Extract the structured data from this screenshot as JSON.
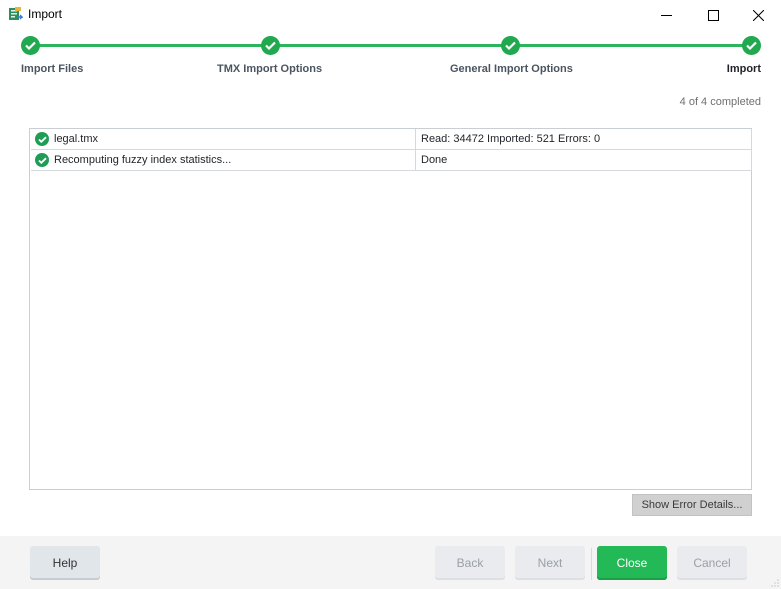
{
  "window": {
    "title": "Import",
    "app_icon": "import-wizard-icon",
    "controls": [
      "minimize",
      "maximize",
      "close"
    ]
  },
  "stepper": {
    "steps": [
      {
        "label": "Import Files",
        "status": "completed"
      },
      {
        "label": "TMX Import Options",
        "status": "completed"
      },
      {
        "label": "General Import Options",
        "status": "completed"
      },
      {
        "label": "Import",
        "status": "completed",
        "current": true
      }
    ],
    "progress_text": "4 of 4 completed",
    "accent_color": "#22a84f"
  },
  "results": {
    "rows": [
      {
        "icon": "check-circle-icon",
        "name": "legal.tmx",
        "status": "Read: 34472 Imported: 521 Errors: 0"
      },
      {
        "icon": "check-circle-icon",
        "name": "Recomputing fuzzy index statistics...",
        "status": "Done"
      }
    ]
  },
  "actions": {
    "show_error_details": "Show Error Details..."
  },
  "footer": {
    "help": "Help",
    "back": "Back",
    "next": "Next",
    "close": "Close",
    "cancel": "Cancel"
  }
}
